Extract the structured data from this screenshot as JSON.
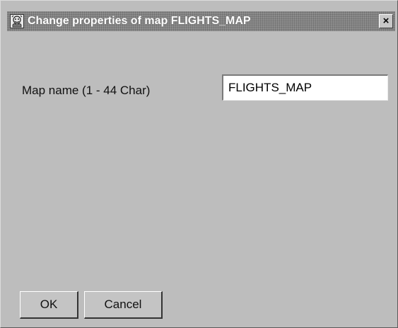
{
  "window": {
    "title": "Change properties of map FLIGHTS_MAP",
    "app_icon": "application-icon",
    "close_label": "×"
  },
  "form": {
    "map_name_label": "Map name (1 - 44 Char)",
    "map_name_value": "FLIGHTS_MAP"
  },
  "buttons": {
    "ok_label": "OK",
    "cancel_label": "Cancel"
  },
  "colors": {
    "dialog_background": "#bdbdbd",
    "title_bar": "#8c8c8c",
    "title_text": "#ffffff"
  }
}
